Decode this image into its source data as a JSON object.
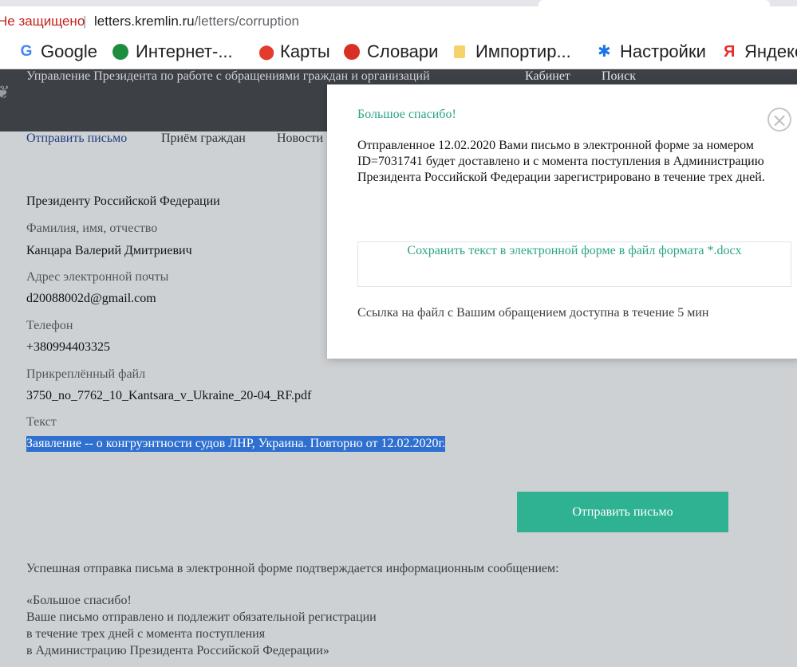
{
  "browser": {
    "insecure_label": "Не защищено",
    "separator": "|",
    "url_host": "letters.kremlin.ru",
    "url_path": "/letters/corruption",
    "bookmarks": [
      {
        "label": "",
        "icon": "app-icon"
      },
      {
        "label": "Google",
        "icon": "google-icon"
      },
      {
        "label": "Интернет-...",
        "icon": "internet-icon"
      },
      {
        "label": "Карты",
        "icon": "maps-pin-icon"
      },
      {
        "label": "Словари",
        "icon": "dictionary-icon"
      },
      {
        "label": "Импортир...",
        "icon": "folder-icon"
      },
      {
        "label": "Настройки",
        "icon": "gear-icon"
      },
      {
        "label": "Яндекс",
        "icon": "yandex-icon"
      }
    ]
  },
  "site": {
    "title": "Управление Президента по работе с обращениями граждан и организаций",
    "nav_cabinet": "Кабинет",
    "nav_search": "Поиск",
    "menu": {
      "send_letter": "Отправить письмо",
      "reception": "Приём граждан",
      "news": "Новости"
    }
  },
  "form": {
    "recipient": "Президенту Российской Федерации",
    "name_label": "Фамилия, имя, отчество",
    "name_value": "Канцара Валерий Дмитриевич",
    "email_label": "Адрес электронной почты",
    "email_value": "d20088002d@gmail.com",
    "phone_label": "Телефон",
    "phone_value": "+380994403325",
    "file_label": "Прикреплённый файл",
    "file_value": "3750_no_7762_10_Kantsara_v_Ukraine_20-04_RF.pdf",
    "text_label": "Текст",
    "text_value": "Заявление -- о конгруэнтности судов ЛНР, Украина. Повторно от 12.02.2020г.",
    "submit_label": "Отправить письмо"
  },
  "info": {
    "line1": "Успешная отправка письма в электронной форме подтверждается информационным сообщением:",
    "quote": [
      "«Большое спасибо!",
      "Ваше письмо отправлено и подлежит обязательной регистрации",
      "в течение трех дней с момента поступления",
      "в Администрацию Президента Российской Федерации»"
    ]
  },
  "modal": {
    "title": "Большое спасибо!",
    "close_symbol": "×",
    "message": "Отправленное 12.02.2020 Вами письмо в электронной форме за номером ID=7031741 будет доставлено и с момента поступления в Администрацию Президента Российской Федерации зарегистрировано в течение трех дней.",
    "docx_link": "Сохранить текст в электронной форме в файл формата *.docx",
    "availability": "Ссылка на файл с Вашим обращением доступна в течение 5 мин"
  },
  "colors": {
    "accent_green": "#2eb291",
    "header_dark": "#3d4045",
    "page_bg": "#ced1d4",
    "selection": "#2f6fcf"
  }
}
